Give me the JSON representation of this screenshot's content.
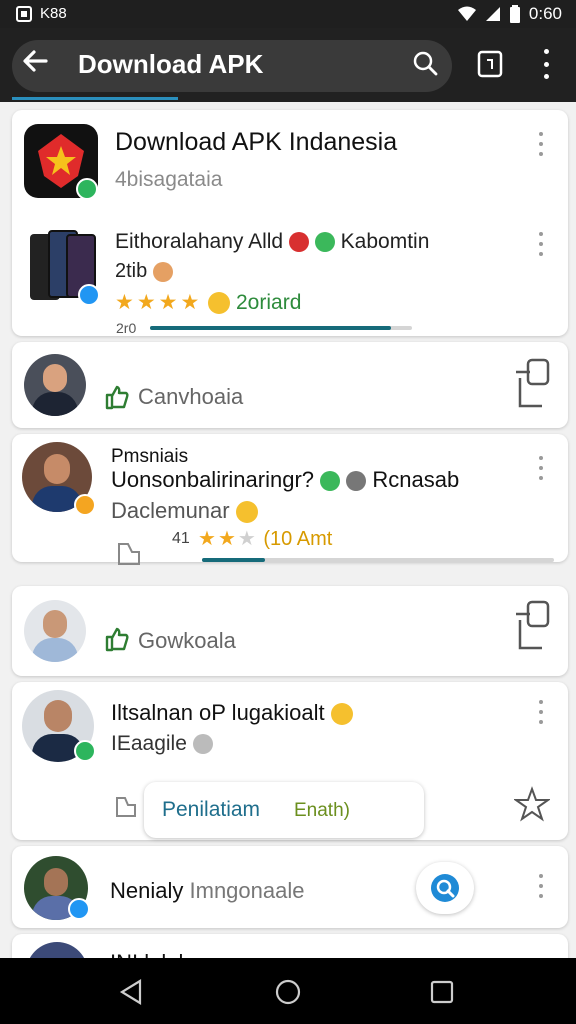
{
  "status_bar": {
    "carrier": "K88",
    "time": "0:60"
  },
  "app_bar": {
    "title": "Download APK"
  },
  "app_header": {
    "name": "Download APK Indanesia",
    "subtitle": "4bisagataia"
  },
  "featured": {
    "line1": "Eithoralahany Alld",
    "line1b": "Kabomtin",
    "line2": "2tib",
    "rating_text": "2oriard",
    "progress_label": "2r0",
    "rating": 4,
    "progress": 0.92
  },
  "reviews": [
    {
      "label": "Canvhoaia"
    },
    {
      "name": "Pmsniais",
      "line1": "Uonsonbalirinaringr?",
      "line1b": "Rcnasab",
      "line2": "Daclemunar",
      "count": "41",
      "tag": "(10 Amt",
      "rating": 2,
      "progress": 0.18
    },
    {
      "label": "Gowkoala"
    },
    {
      "line1": "Iltsalnan oP lugakioalt",
      "line2": "IEaagile"
    },
    {
      "input_text": "Penilatiam",
      "input_hint": "Enath)"
    },
    {
      "name": "Nenialy",
      "subtitle": "Imngonaale"
    },
    {
      "name": "INI lalak"
    }
  ],
  "colors": {
    "accent": "#166b7a",
    "star": "#f2a81d",
    "like": "#2e7d32",
    "badge_green": "#2db55d",
    "badge_blue": "#2196f3",
    "badge_orange": "#f4a521"
  }
}
